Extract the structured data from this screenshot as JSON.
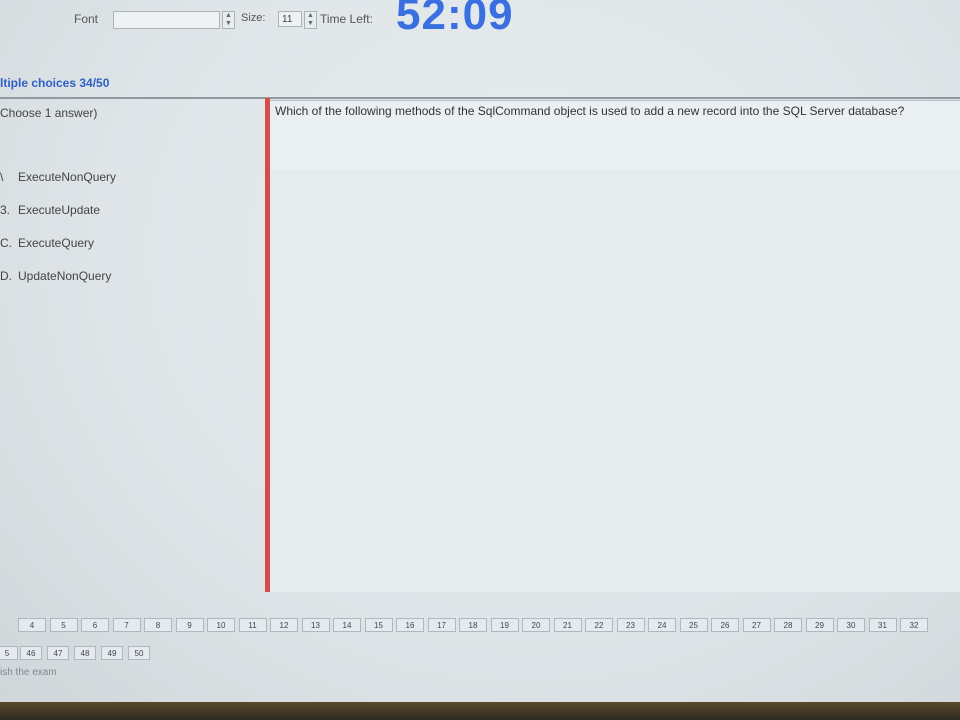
{
  "toolbar": {
    "font_label": "Font",
    "size_label": "Size:",
    "size_value": "11",
    "time_left_label": "Time Left:",
    "timer": "52:09"
  },
  "section": {
    "title": "ltiple choices 34/50"
  },
  "instruction": "Choose 1 answer)",
  "choices": [
    {
      "letter": "\\",
      "text": "ExecuteNonQuery"
    },
    {
      "letter": "3.",
      "text": "ExecuteUpdate"
    },
    {
      "letter": "C.",
      "text": "ExecuteQuery"
    },
    {
      "letter": "D.",
      "text": "UpdateNonQuery"
    }
  ],
  "question": {
    "text": "Which of the following methods of the SqlCommand object is used to add a new record into the SQL Server database?"
  },
  "pager": {
    "row1": [
      "4",
      "5",
      "6",
      "7",
      "8",
      "9",
      "10",
      "11",
      "12",
      "13",
      "14",
      "15",
      "16",
      "17",
      "18",
      "19",
      "20",
      "21",
      "22",
      "23",
      "24",
      "25",
      "26",
      "27",
      "28",
      "29",
      "30",
      "31",
      "32"
    ],
    "row2": [
      "5",
      "46",
      "47",
      "48",
      "49",
      "50"
    ]
  },
  "finish_label": "ish the exam",
  "colors": {
    "accent": "#3a6fe0",
    "divider": "#d94b4b",
    "section": "#2f5fc8"
  }
}
